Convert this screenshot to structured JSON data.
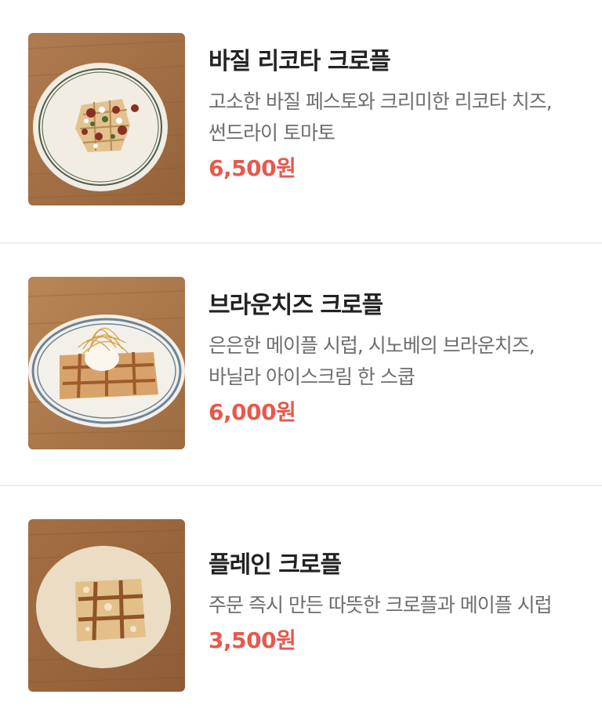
{
  "menu": {
    "items": [
      {
        "name": "바질 리코타 크로플",
        "description_line1": "고소한 바질 페스토와 크리미한 리코타 치즈,",
        "description_line2": "썬드라이 토마토",
        "price": "6,500원"
      },
      {
        "name": "브라운치즈 크로플",
        "description_line1": "은은한 메이플 시럽, 시노베의 브라운치즈,",
        "description_line2": "바닐라 아이스크림 한 스쿱",
        "price": "6,000원"
      },
      {
        "name": "플레인 크로플",
        "description_line1": "주문 즉시 만든 따뜻한 크로플과 메이플 시럽",
        "description_line2": "",
        "price": "3,500원"
      }
    ]
  },
  "colors": {
    "price": "#e8584c",
    "name": "#222222",
    "description": "#6e6e6e",
    "divider": "#efefef",
    "wood": "#a8734a"
  }
}
